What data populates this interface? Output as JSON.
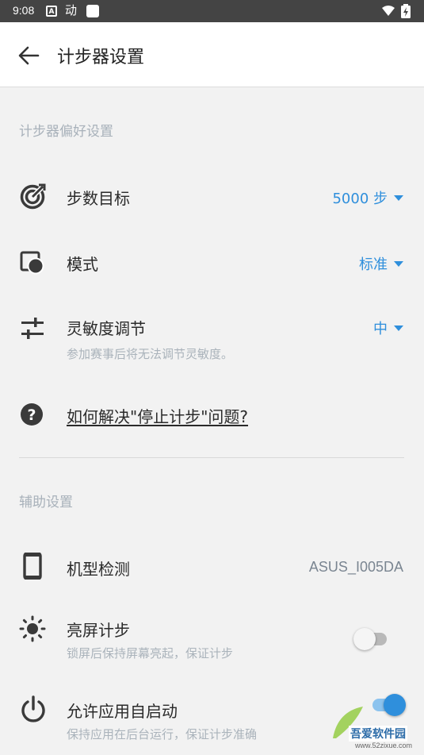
{
  "status_bar": {
    "time": "9:08",
    "app_icon_a": "A",
    "app_icon_b": "动"
  },
  "app_bar": {
    "title": "计步器设置"
  },
  "sections": {
    "pedometer_prefs": "计步器偏好设置",
    "assist_settings": "辅助设置"
  },
  "rows": {
    "step_goal": {
      "label": "步数目标",
      "value": "5000 步",
      "icon": "target-icon"
    },
    "mode": {
      "label": "模式",
      "value": "标准",
      "icon": "mode-icon"
    },
    "sensitivity": {
      "label": "灵敏度调节",
      "sub": "参加赛事后将无法调节灵敏度。",
      "value": "中",
      "icon": "sliders-icon"
    },
    "help": {
      "label": "如何解决\"停止计步\"问题?",
      "icon": "help-icon"
    },
    "device": {
      "label": "机型检测",
      "value": "ASUS_I005DA",
      "icon": "phone-icon"
    },
    "screen_on": {
      "label": "亮屏计步",
      "sub": "锁屏后保持屏幕亮起，保证计步",
      "icon": "brightness-icon",
      "enabled": false
    },
    "autostart": {
      "label": "允许应用自启动",
      "sub": "保持应用在后台运行，保证计步准确",
      "icon": "power-icon",
      "enabled": true
    }
  },
  "watermark": {
    "text": "吾爱软件园",
    "url": "www.52zixue.com"
  },
  "colors": {
    "accent": "#2f8fdc",
    "secondary_text": "#aab3bb",
    "status_bar": "#444444"
  }
}
